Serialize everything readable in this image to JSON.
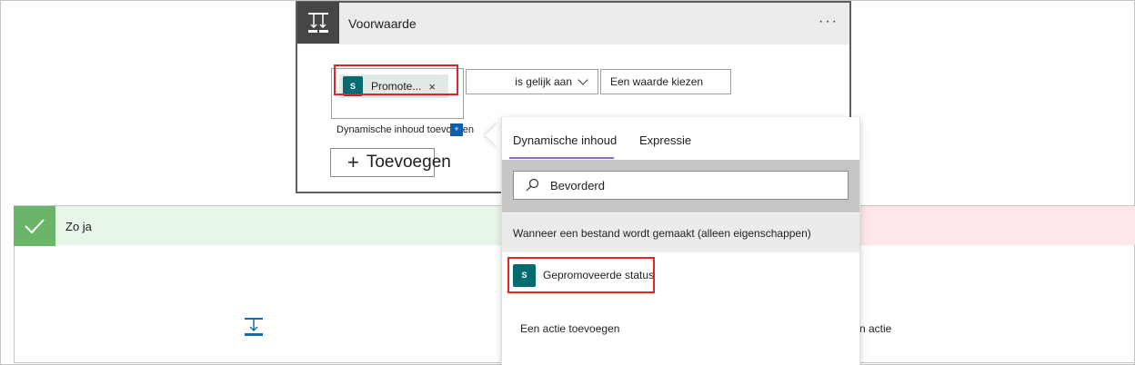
{
  "condition": {
    "title": "Voorwaarde",
    "more_label": "···",
    "token_label": "Promote...",
    "token_close": "×",
    "operator": "is gelijk aan",
    "value_placeholder": "Een waarde kiezen",
    "dynamic_link": "Dynamische inhoud toevoegen",
    "add_button": "Toevoegen"
  },
  "branches": {
    "yes_label": "Zo ja",
    "right_action_text": "n actie"
  },
  "panel": {
    "tabs": [
      "Dynamische inhoud",
      "Expressie"
    ],
    "search_value": "Bevorderd",
    "section_header": "Wanneer een bestand wordt gemaakt (alleen eigenschappen)",
    "result_label": "Gepromoveerde status",
    "add_action": "Een actie toevoegen"
  },
  "colors": {
    "highlight_red": "#e3222a",
    "sharepoint_teal": "#036c70",
    "yes_green": "#6bb56b",
    "tab_accent": "#8a6fd1"
  },
  "icons": {
    "condition": "condition-icon",
    "sharepoint": "sharepoint-icon",
    "search": "search-icon",
    "check": "check-icon",
    "add_action": "add-action-icon"
  }
}
